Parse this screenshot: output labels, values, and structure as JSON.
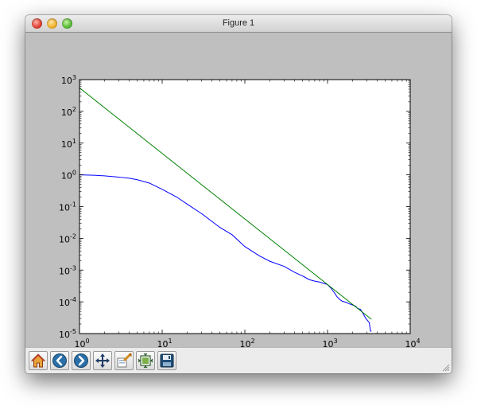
{
  "window": {
    "title": "Figure 1"
  },
  "toolbar": {
    "buttons": [
      {
        "icon": "home-icon"
      },
      {
        "icon": "back-icon"
      },
      {
        "icon": "forward-icon"
      },
      {
        "icon": "pan-icon"
      },
      {
        "icon": "zoom-icon"
      },
      {
        "icon": "subplots-icon"
      },
      {
        "icon": "save-icon"
      }
    ]
  },
  "chart_data": {
    "type": "line",
    "title": "",
    "xlabel": "",
    "ylabel": "",
    "x_scale": "log",
    "y_scale": "log",
    "xlim": [
      1,
      10000
    ],
    "ylim": [
      1e-05,
      1000
    ],
    "grid": false,
    "x_ticks": [
      {
        "value": 1,
        "base": "10",
        "exp": "0"
      },
      {
        "value": 10,
        "base": "10",
        "exp": "1"
      },
      {
        "value": 100,
        "base": "10",
        "exp": "2"
      },
      {
        "value": 1000,
        "base": "10",
        "exp": "3"
      },
      {
        "value": 10000,
        "base": "10",
        "exp": "4"
      }
    ],
    "y_ticks": [
      {
        "value": 1000,
        "base": "10",
        "exp": "3"
      },
      {
        "value": 100,
        "base": "10",
        "exp": "2"
      },
      {
        "value": 10,
        "base": "10",
        "exp": "1"
      },
      {
        "value": 1,
        "base": "10",
        "exp": "0"
      },
      {
        "value": 0.1,
        "base": "10",
        "exp": "-1"
      },
      {
        "value": 0.01,
        "base": "10",
        "exp": "-2"
      },
      {
        "value": 0.001,
        "base": "10",
        "exp": "-3"
      },
      {
        "value": 0.0001,
        "base": "10",
        "exp": "-4"
      },
      {
        "value": 1e-05,
        "base": "10",
        "exp": "-5"
      }
    ],
    "series": [
      {
        "color": "#0000ff",
        "x": [
          1,
          1.5,
          2,
          3,
          4,
          5,
          7,
          10,
          15,
          20,
          30,
          50,
          70,
          100,
          150,
          200,
          300,
          400,
          500,
          600,
          700,
          800,
          900,
          1000,
          1100,
          1200,
          1300,
          1400,
          1500,
          1600,
          1700,
          1800,
          2000,
          2200,
          2300,
          2400,
          2500,
          2700,
          2900,
          3200,
          3300,
          3400
        ],
        "y": [
          1.0,
          0.97,
          0.93,
          0.85,
          0.78,
          0.7,
          0.55,
          0.35,
          0.2,
          0.12,
          0.06,
          0.022,
          0.013,
          0.0055,
          0.0028,
          0.0019,
          0.0013,
          0.00085,
          0.00065,
          0.0005,
          0.00045,
          0.00042,
          0.00038,
          0.00035,
          0.00027,
          0.0002,
          0.000145,
          0.00012,
          0.000105,
          0.0001,
          9.5e-05,
          8.8e-05,
          8e-05,
          7.2e-05,
          6.2e-05,
          6e-05,
          5.8e-05,
          4.2e-05,
          3e-05,
          2.2e-05,
          1.2e-05,
          1.2e-05
        ]
      },
      {
        "color": "#008000",
        "x": [
          1,
          3400
        ],
        "y": [
          550,
          2.8e-05
        ]
      }
    ]
  }
}
